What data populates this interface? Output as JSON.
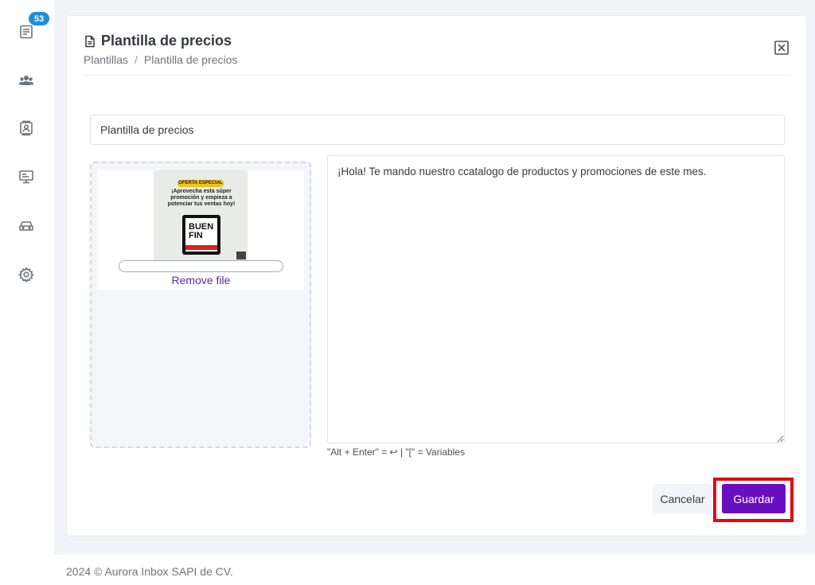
{
  "sidebar": {
    "badge_count": "53",
    "items": [
      {
        "icon": "inbox-icon"
      },
      {
        "icon": "users-icon"
      },
      {
        "icon": "contact-card-icon"
      },
      {
        "icon": "monitor-icon"
      },
      {
        "icon": "car-icon"
      },
      {
        "icon": "gear-icon"
      }
    ]
  },
  "header": {
    "title": "Plantilla de precios",
    "breadcrumb": [
      "Plantillas",
      "Plantilla de precios"
    ],
    "breadcrumb_separator": "/"
  },
  "form": {
    "template_name_value": "Plantilla de precios",
    "message_value": "¡Hola! Te mando nuestro ccatalogo de productos y promociones de este mes.",
    "hint": "\"Alt + Enter\" = ↩ |   \"[\" = Variables"
  },
  "upload": {
    "remove_label": "Remove file",
    "progress": 0,
    "thumbnail": {
      "tag": "OFERTA ESPECIAL",
      "headline": "¡Aprovecha esta súper promoción y empieza a potenciar tus ventas hoy!",
      "box_text": "BUEN FIN"
    }
  },
  "actions": {
    "cancel_label": "Cancelar",
    "save_label": "Guardar"
  },
  "footer": {
    "text": "2024 © Aurora Inbox SAPI de CV."
  },
  "colors": {
    "accent": "#6a0fc0",
    "badge": "#1b8fd6",
    "highlight_frame": "#e30613"
  }
}
